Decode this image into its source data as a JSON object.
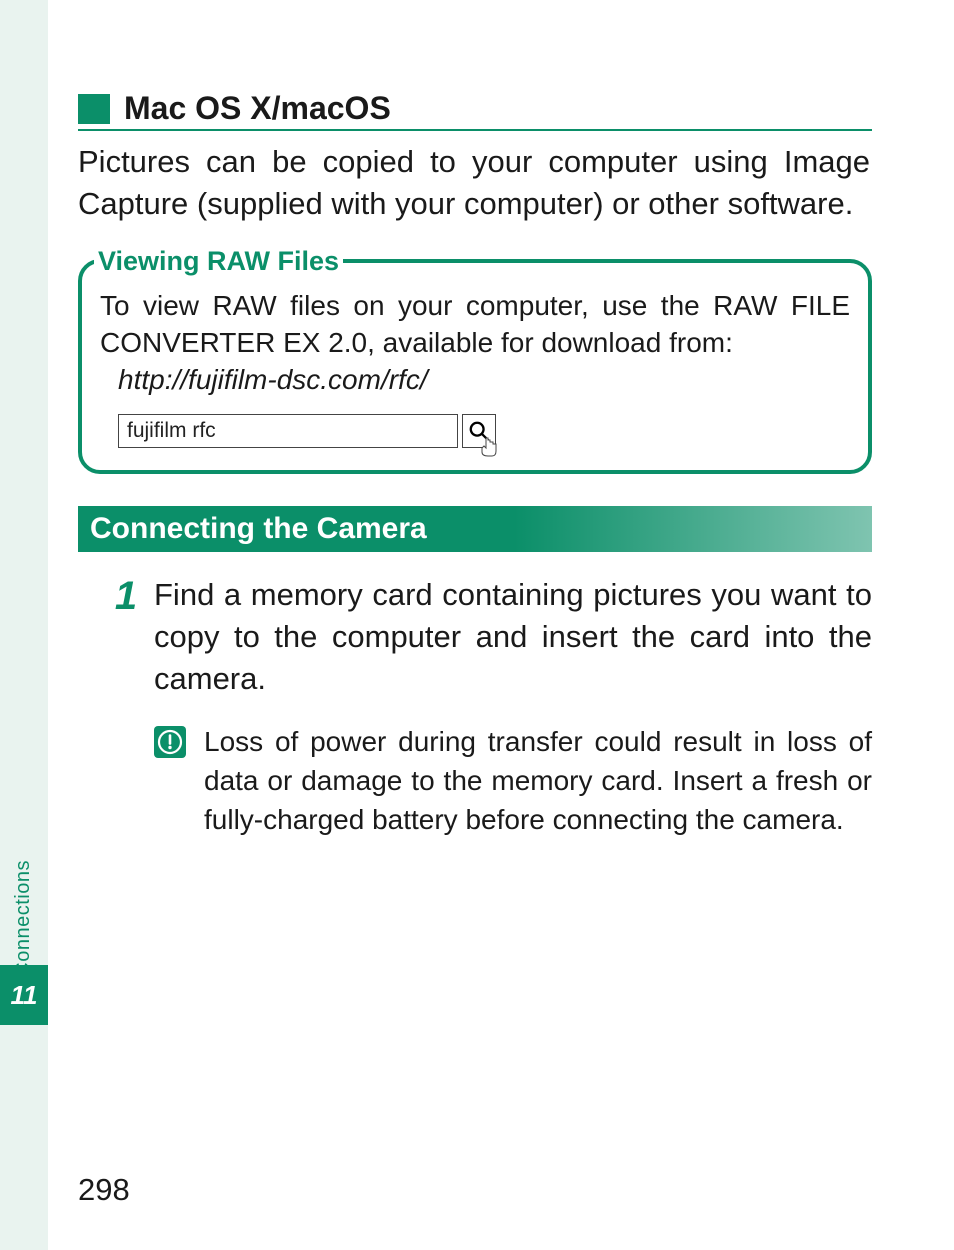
{
  "side": {
    "section_label": "Connections",
    "chapter_number": "11"
  },
  "heading": "Mac OS X/macOS",
  "intro_paragraph": "Pictures can be copied to your computer using Image Capture (supplied with your computer) or other software.",
  "callout": {
    "title": "Viewing RAW Files",
    "body": "To view RAW files on your computer, use the RAW FILE CONVERTER EX 2.0, available for download from:",
    "url": "http://fujifilm-dsc.com/rfc/",
    "search_value": "fujifilm rfc"
  },
  "section_title": "Connecting the Camera",
  "step": {
    "number": "1",
    "text": "Find a memory card containing pictures you want to copy to the computer and insert the card into the camera."
  },
  "caution": "Loss of power during transfer could result in loss of data or damage to the memory card.  Insert a fresh or fully-charged battery before connecting the camera.",
  "page_number": "298"
}
